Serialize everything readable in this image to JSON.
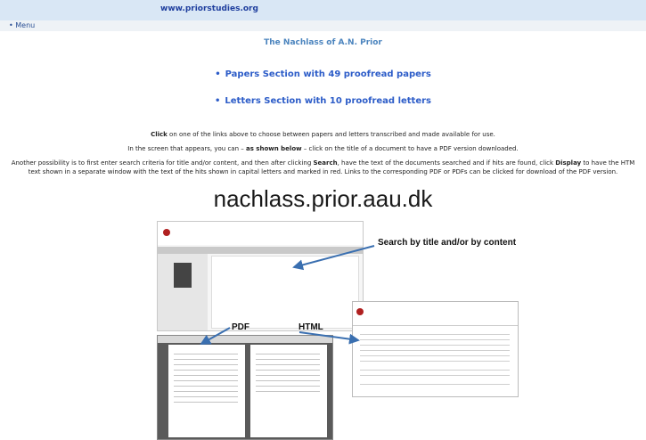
{
  "header": {
    "site_url": "www.priorstudies.org"
  },
  "menu": {
    "label": "• Menu"
  },
  "main": {
    "title": "The Nachlass of A.N. Prior",
    "papers_link": "Papers Section with 49 proofread papers",
    "letters_link": "Letters Section with 10 proofread letters",
    "para1_bold": "Click",
    "para1_rest": " on one of the links above to choose between papers and letters transcribed and made available for use.",
    "para2_a": "In the screen that appears, you can – ",
    "para2_bold": "as shown below",
    "para2_b": " – click on the title of a document to have a PDF version downloaded.",
    "para3_a": "Another possibility is to first enter search criteria for title and/or content, and then after clicking ",
    "para3_bold1": "Search",
    "para3_b": ", have the text of the documents searched and if hits are found, click ",
    "para3_bold2": "Display",
    "para3_c": " to have the HTM",
    "para3_line2": "text shown in a separate window with the text of the hits shown in capital letters and marked in red. Links to the corresponding PDF or PDFs can be clicked for download of the PDF version."
  },
  "illustration": {
    "site_heading": "nachlass.prior.aau.dk",
    "callout_search": "Search by title and/or by content",
    "callout_pdf": "PDF",
    "callout_html": "HTML"
  },
  "colors": {
    "topbar": "#d9e7f5",
    "link": "#2c5cc8",
    "title": "#4b84be",
    "arrow": "#3a6fb0"
  }
}
